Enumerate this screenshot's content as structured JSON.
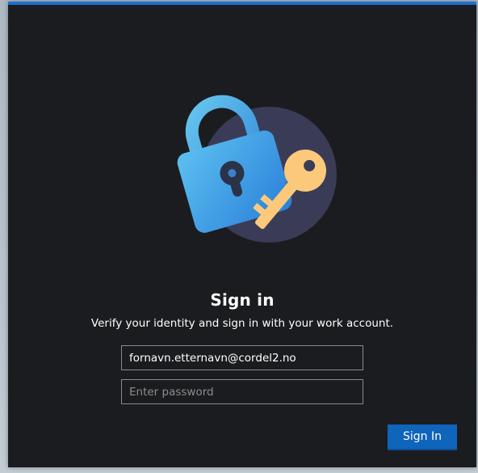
{
  "dialog": {
    "title": "Sign in",
    "subtitle": "Verify your identity and sign in with your work account.",
    "illustration_icon": "lock-and-key-icon",
    "email_value": "fornavn.etternavn@cordel2.no",
    "password_placeholder": "Enter password",
    "sign_in_label": "Sign In"
  },
  "colors": {
    "accent": "#0f64bb",
    "top_border": "#1e6fd0",
    "background": "#1b1c1f",
    "lock_blue": "#3aa0e8",
    "key_gold": "#fcc97a"
  }
}
